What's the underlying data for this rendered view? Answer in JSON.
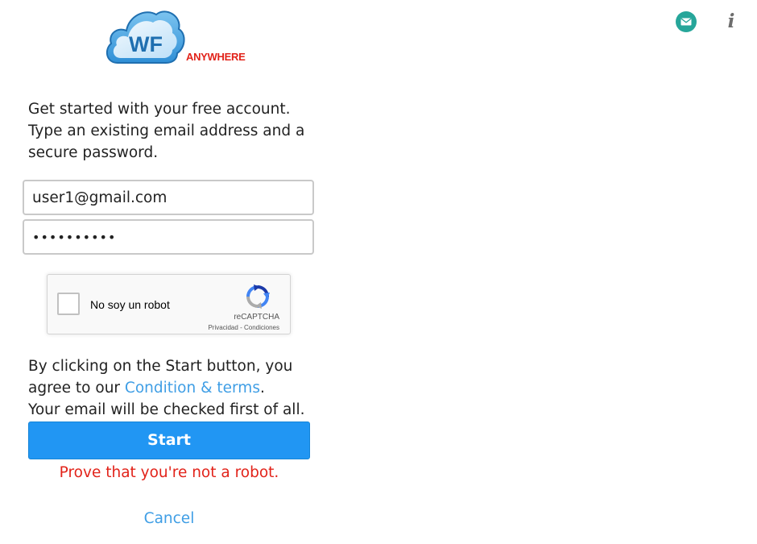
{
  "brand": {
    "logo_initials": "WF",
    "logo_text": "ANYWHERE",
    "colors": {
      "cloud": "#4aa3de",
      "cloud_dark": "#1f6fb0",
      "accent_red": "#e2231a"
    }
  },
  "header": {
    "mail_icon": "envelope-icon",
    "mail_icon_color": "#26a69a",
    "info_icon": "info-icon",
    "info_glyph": "i"
  },
  "intro": {
    "lines": [
      "Get started with your free account.",
      "Type an existing email address and a",
      "secure password."
    ]
  },
  "form": {
    "email_value": "user1@gmail.com",
    "password_value": "••••••••••"
  },
  "captcha": {
    "label": "No soy un robot",
    "brand": "reCAPTCHA",
    "privacy_link": "Privacidad",
    "separator": "-",
    "terms_link": "Condiciones",
    "checked": false
  },
  "consent": {
    "line1": "By clicking on the Start button, you",
    "line2_prefix": "agree to our ",
    "terms_link": "Condition & terms",
    "line2_suffix": ".",
    "line3": "Your email will be checked first of all."
  },
  "actions": {
    "start_label": "Start",
    "error_message": "Prove that you're not a robot.",
    "cancel_label": "Cancel"
  },
  "colors": {
    "primary_button": "#2196f3",
    "link": "#3f9ee5",
    "error": "#e2231a"
  }
}
